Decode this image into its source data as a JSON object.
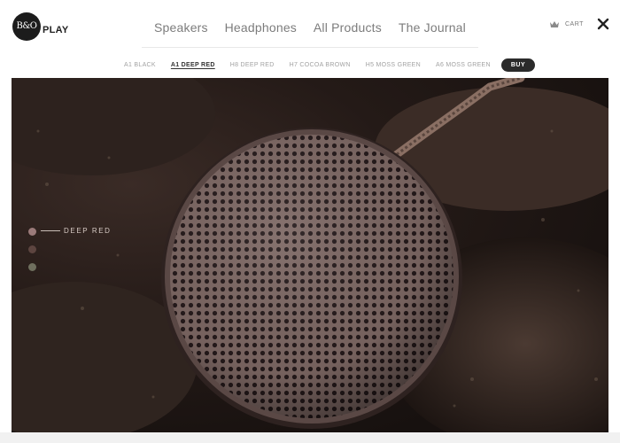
{
  "brand": {
    "logo_mark": "B&O",
    "wordmark": "PLAY"
  },
  "main_nav": [
    "Speakers",
    "Headphones",
    "All Products",
    "The Journal"
  ],
  "cart_label": "CART",
  "product_nav": {
    "items": [
      "A1 BLACK",
      "A1 DEEP RED",
      "H8 DEEP RED",
      "H7 COCOA BROWN",
      "H5 MOSS GREEN",
      "A6 MOSS GREEN"
    ],
    "active": "A1 DEEP RED",
    "buy_label": "BUY"
  },
  "hero": {
    "selected_color_label": "DEEP RED",
    "swatches": [
      {
        "name": "deep-red",
        "color": "#9b7b7a"
      },
      {
        "name": "brown",
        "color": "#5d4540"
      },
      {
        "name": "moss-green",
        "color": "#6f6f5e"
      }
    ],
    "speaker_color": "#7b6662"
  },
  "colors": {
    "accent_dark": "#2b2b2b",
    "nav_text": "#7c7c7c",
    "subnav_text": "#a2a2a2"
  }
}
